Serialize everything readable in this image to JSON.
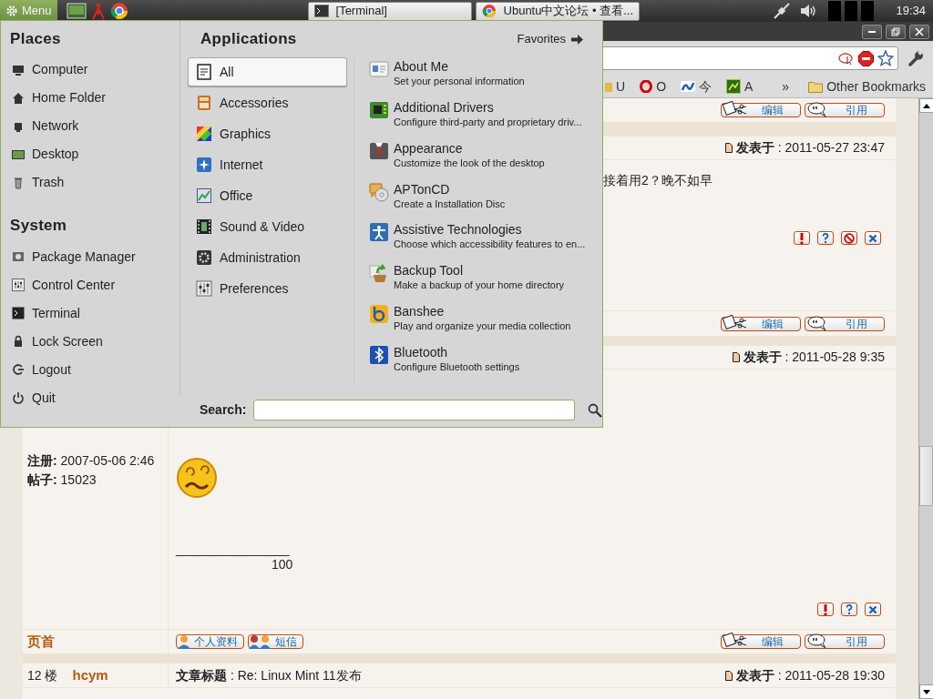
{
  "panel": {
    "menu_label": "Menu",
    "tasks": [
      {
        "label": "[Terminal]",
        "kind": "terminal"
      },
      {
        "label": "Ubuntu中文论坛 • 查看...",
        "kind": "browser"
      }
    ],
    "clock": "19:34"
  },
  "browser": {
    "bookmarks": [
      {
        "label": "U",
        "kind": "folder"
      },
      {
        "label": "O",
        "kind": "opera"
      },
      {
        "label": "今",
        "kind": "news"
      },
      {
        "label": "A",
        "kind": "app"
      }
    ],
    "overflow": "»",
    "other_bookmarks": "Other Bookmarks"
  },
  "forum": {
    "rows": [
      {
        "kind": "actions",
        "buttons": [
          {
            "kind": "edit",
            "label": "编辑"
          },
          {
            "kind": "quote",
            "label": "引用"
          }
        ]
      },
      {
        "kind": "divider"
      },
      {
        "kind": "header",
        "posted": "**发表于** : 2011-05-27 23:47"
      },
      {
        "kind": "body",
        "content": [
          {
            "kind": "text",
            "text": "接着用2？晚不如早"
          }
        ],
        "mod_buttons": [
          {
            "kind": "report"
          },
          {
            "kind": "question"
          },
          {
            "kind": "ban"
          },
          {
            "kind": "delete"
          }
        ]
      },
      {
        "kind": "actions",
        "buttons": [
          {
            "kind": "edit",
            "label": "编辑"
          },
          {
            "kind": "quote",
            "label": "引用"
          }
        ]
      },
      {
        "kind": "divider"
      },
      {
        "kind": "header",
        "posted": "**发表于** : 2011-05-28 9:35"
      },
      {
        "kind": "body",
        "user_info": [
          "**注册:** 2007-05-06 2:46",
          "**帖子:** 15023"
        ],
        "content": [
          {
            "kind": "emoticon"
          },
          {
            "kind": "signature",
            "line": "________________",
            "text": "100"
          }
        ],
        "mod_buttons": [
          {
            "kind": "report"
          },
          {
            "kind": "question"
          },
          {
            "kind": "delete"
          }
        ]
      },
      {
        "kind": "actions",
        "top_link": "页首",
        "profile_buttons": [
          {
            "kind": "profile",
            "label": "个人资料"
          },
          {
            "kind": "message",
            "label": "短信"
          }
        ],
        "buttons": [
          {
            "kind": "edit",
            "label": "编辑"
          },
          {
            "kind": "quote",
            "label": "引用"
          }
        ]
      },
      {
        "kind": "divider"
      },
      {
        "kind": "header",
        "floor": "12 楼",
        "author": "hcym",
        "subject": "**文章标题** : Re: Linux Mint 11发布",
        "posted": "**发表于** : 2011-05-28 19:30"
      }
    ]
  },
  "menu": {
    "places_title": "Places",
    "places": [
      "Computer",
      "Home Folder",
      "Network",
      "Desktop",
      "Trash"
    ],
    "system_title": "System",
    "system": [
      "Package Manager",
      "Control Center",
      "Terminal",
      "Lock Screen",
      "Logout",
      "Quit"
    ],
    "applications_title": "Applications",
    "favorites": "Favorites",
    "categories": [
      {
        "label": "All",
        "selected": true
      },
      {
        "label": "Accessories",
        "selected": false
      },
      {
        "label": "Graphics",
        "selected": false
      },
      {
        "label": "Internet",
        "selected": false
      },
      {
        "label": "Office",
        "selected": false
      },
      {
        "label": "Sound & Video",
        "selected": false
      },
      {
        "label": "Administration",
        "selected": false
      },
      {
        "label": "Preferences",
        "selected": false
      }
    ],
    "apps": [
      {
        "name": "About Me",
        "description": "Set your personal information"
      },
      {
        "name": "Additional Drivers",
        "description": "Configure third-party and proprietary driv..."
      },
      {
        "name": "Appearance",
        "description": "Customize the look of the desktop"
      },
      {
        "name": "APTonCD",
        "description": "Create a Installation Disc"
      },
      {
        "name": "Assistive Technologies",
        "description": "Choose which accessibility features to en..."
      },
      {
        "name": "Backup Tool",
        "description": "Make a backup of your home directory"
      },
      {
        "name": "Banshee",
        "description": "Play and organize your media collection"
      },
      {
        "name": "Bluetooth",
        "description": "Configure Bluetooth settings"
      }
    ],
    "search_label": "Search:"
  }
}
